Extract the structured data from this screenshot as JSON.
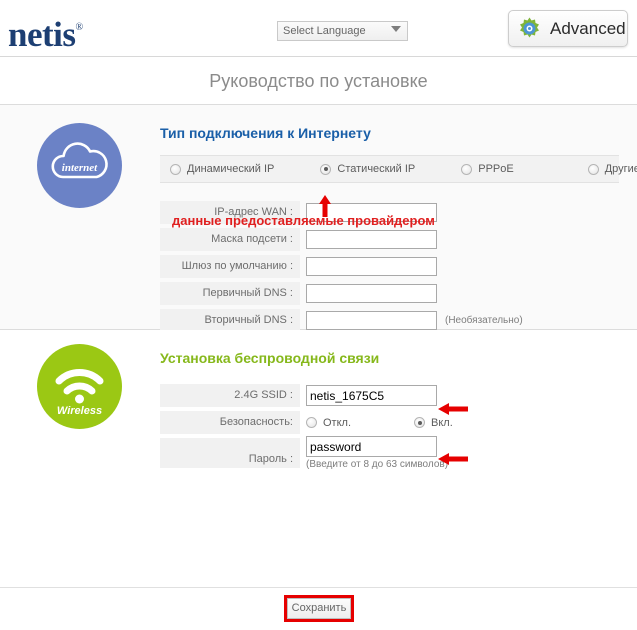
{
  "header": {
    "logo_text": "netis",
    "logo_trademark": "®",
    "language_select": "Select Language",
    "advanced_label": "Advanced",
    "gear_icon": "gear-icon",
    "caret_icon": "chevron-down-icon"
  },
  "page_title": "Руководство по установке",
  "internet_section": {
    "icon_label": "internet",
    "heading": "Тип подключения к Интернету",
    "connection_types": [
      {
        "label": "Динамический IP",
        "selected": false
      },
      {
        "label": "Статический IP",
        "selected": true
      },
      {
        "label": "PPPoE",
        "selected": false
      },
      {
        "label": "Другие",
        "selected": false
      }
    ],
    "fields": [
      {
        "label": "IP-адрес WAN :",
        "value": "",
        "hint": ""
      },
      {
        "label": "Маска подсети :",
        "value": "",
        "hint": ""
      },
      {
        "label": "Шлюз по умолчанию :",
        "value": "",
        "hint": ""
      },
      {
        "label": "Первичный DNS :",
        "value": "",
        "hint": ""
      },
      {
        "label": "Вторичный DNS :",
        "value": "",
        "hint": "(Необязательно)"
      }
    ]
  },
  "wireless_section": {
    "icon_label": "Wireless",
    "heading": "Установка беспроводной связи",
    "ssid_label": "2.4G SSID :",
    "ssid_value": "netis_1675C5",
    "security_label": "Безопасность:",
    "security_options": [
      {
        "label": "Откл.",
        "selected": false
      },
      {
        "label": "Вкл.",
        "selected": true
      }
    ],
    "password_label": "Пароль :",
    "password_value": "password",
    "password_hint": "(Введите от 8 до 63 символов)"
  },
  "annotations": {
    "provider_note": "данные предоставляемые провайдером",
    "arrow_static_ip": "arrow-up-icon",
    "arrow_ssid": "arrow-left-icon",
    "arrow_password": "arrow-left-icon",
    "highlight_save": "red-box-highlight",
    "color": "#e02020"
  },
  "footer": {
    "save_label": "Сохранить"
  }
}
